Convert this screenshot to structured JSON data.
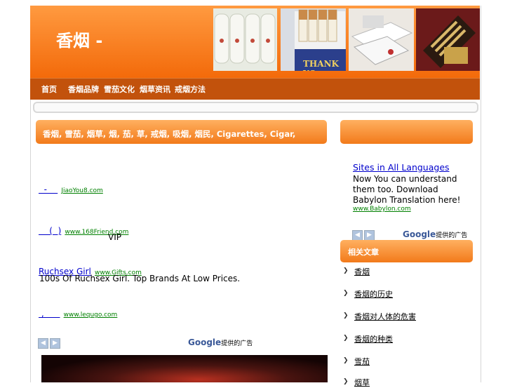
{
  "site": {
    "title": "香烟 -"
  },
  "header": {
    "photos": [
      "cigarette-ends-photo",
      "cigarette-pack-thank-you-photo",
      "cigarette-boxes-photo",
      "cigarette-case-photo"
    ],
    "photo_caption": "THANK YO"
  },
  "nav": {
    "items": [
      "首页",
      "香烟品牌",
      "雪茄文化",
      "烟草资讯",
      "戒烟方法"
    ]
  },
  "main": {
    "title": "香烟, 雪茄, 烟草, 烟, 茄, 草, 戒烟, 吸烟, 烟民, Cigarettes, Cigar, Tobacoo, Quit, Smoking",
    "ads": [
      {
        "link": "  -    ",
        "url": "JiaoYou8.com",
        "desc": ""
      },
      {
        "link": "    (  )",
        "url": "www.168Friend.com",
        "desc": "VIP"
      },
      {
        "link": "Ruchsex Girl",
        "url": "www.Gifts.com",
        "desc": "100s Of Ruchsex Girl. Top Brands At Low Prices."
      },
      {
        "link": " ,      ",
        "url": "www.lequgo.com",
        "desc": ""
      }
    ],
    "ads_by": "Google",
    "ads_by_suffix": "提供的广告",
    "prev_icon": "chevron-left-icon",
    "next_icon": "chevron-right-icon"
  },
  "sidebar": {
    "ad": {
      "link": "Sites in All Languages",
      "desc": "Now You can understand them too. Download Babylon Translation here!",
      "url": "www.Babylon.com",
      "ads_by": "Google",
      "ads_by_suffix": "提供的广告"
    },
    "section_title": "相关文章",
    "links": [
      "香烟",
      "香烟的历史",
      "香烟对人体的危害",
      "香烟的种类",
      "雪茄",
      "烟草"
    ]
  },
  "colors": {
    "header_orange": "#f36a0a",
    "nav_brown": "#c2520c",
    "ad_link": "#0000cc",
    "ad_url": "#008000"
  }
}
